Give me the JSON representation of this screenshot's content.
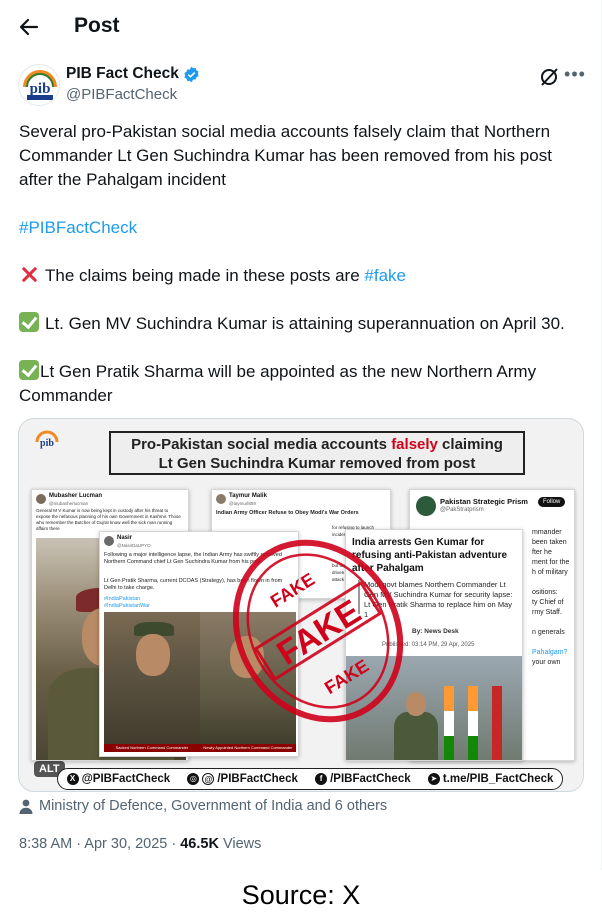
{
  "header": {
    "title": "Post"
  },
  "author": {
    "name": "PIB Fact Check",
    "handle": "@PIBFactCheck"
  },
  "post": {
    "line1": "Several pro-Pakistan social media accounts falsely claim that Northern",
    "line2": "Commander Lt Gen Suchindra Kumar has been removed from his post",
    "line3": "after the Pahalgam incident",
    "hashtag": "#PIBFactCheck",
    "claim_text": "The claims being made in these posts are ",
    "claim_tag": "#fake",
    "fact1": "Lt. Gen MV Suchindra Kumar is attaining superannuation on April 30.",
    "fact2_line1": "Lt Gen Pratik Sharma will be appointed as the new Northern Army",
    "fact2_line2": "Commander"
  },
  "media": {
    "banner_line1_a": "Pro-Pakistan social media accounts ",
    "banner_line1_red": "falsely",
    "banner_line1_b": " claiming",
    "banner_line2": "Lt Gen Suchindra Kumar removed from post",
    "alt": "ALT",
    "card1": {
      "name": "Mubasher Lucman",
      "handle": "@mubasherlucman",
      "text": "General M V Kumar is now being kept in custody after his threat to expose the nefarious planning of his own Government in Kashmir. Those who remember the Butcher of Gujrat know well the sick man running affairs there"
    },
    "card2": {
      "name": "Taymur Malik",
      "handle": "@taymurl859",
      "title": "Indian Army Officer Refuse to Obey Modi's War Orders",
      "frag1": "for refusing to launch",
      "frag2": "incident. He will be",
      "frag3": "but the truth is clea",
      "frag4": "driven war drama.",
      "frag5": "attack"
    },
    "card3": {
      "name": "Pakistan Strategic Prism",
      "handle": "@PakStratprism",
      "follow": "Follow",
      "frag1": "mmander",
      "frag2": "been taken",
      "frag3": "fter he",
      "frag4": "ment for the",
      "frag5": "h of military",
      "frag6": "ositions:",
      "frag7": "ty Chief of",
      "frag8": "rmy Staff.",
      "frag9": "n generals",
      "frag10": "Pahalgam?",
      "frag11": "your own"
    },
    "card4": {
      "name": "Nasir",
      "handle": "@NasirDaUPYO",
      "text1": "Following a major intelligence lapse, the Indian Army has swiftly removed Northern Command chief Lt Gen Suchindra Kumar from his post.",
      "text2": "Lt Gen Pratik Sharma, current DCOAS (Strategy), has been flown in from Delhi to take charge.",
      "tag1": "#IndiaPakistan",
      "tag2": "#IndiaPakistanWar",
      "cap1": "Sacked Northern Command Commander",
      "cap2": "Newly Appointed Northern Command Commander"
    },
    "card5": {
      "headline": "India arrests Gen Kumar for refusing anti-Pakistan adventure after Pahalgam",
      "sub": "Modi govt blames Northern Commander Lt Gen MV Suchindra Kumar for security lapse: Lt Gen Pratik Sharma to replace him on May 1",
      "by": "By: News Desk",
      "published": "Published: 03:14 PM, 29 Apr, 2025"
    },
    "stamp_word": "FAKE",
    "social": [
      "@PIBFactCheck",
      "/PIBFactCheck",
      "/PIBFactCheck",
      "t.me/PIB_FactCheck"
    ]
  },
  "ministry": "Ministry of Defence, Government of India and 6 others",
  "meta": {
    "time": "8:38 AM · Apr 30, 2025 · ",
    "views_count": "46.5K",
    "views_label": " Views"
  },
  "source": "Source: X",
  "colors": {
    "accent": "#1d9bf0",
    "fake_red": "#d0021b",
    "muted": "#536471"
  }
}
